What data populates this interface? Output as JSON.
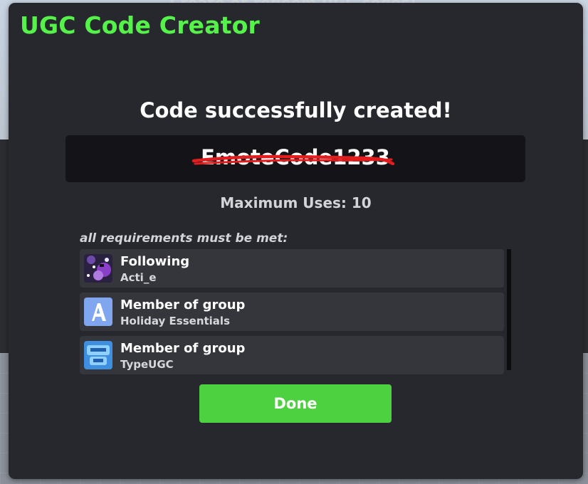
{
  "background": {
    "sign_text": "Create or redeem UGC codes!"
  },
  "modal": {
    "title": "UGC Code Creator",
    "heading": "Code successfully created!",
    "code": "EmoteCode1233",
    "max_uses_label": "Maximum Uses: 10",
    "requirements_caption": "all requirements must be met:",
    "requirements": [
      {
        "title": "Following",
        "subtitle": "Acti_e",
        "icon": "user-avatar-icon"
      },
      {
        "title": "Member of group",
        "subtitle": "Holiday Essentials",
        "icon": "group-logo-a-icon"
      },
      {
        "title": "Member of group",
        "subtitle": "TypeUGC",
        "icon": "group-logo-typeugc-icon"
      }
    ],
    "done_label": "Done"
  },
  "colors": {
    "accent_green": "#55f24a",
    "button_green": "#4ed140",
    "panel": "#27282d",
    "code_box": "#141418",
    "redaction_red": "#e11d1d"
  }
}
